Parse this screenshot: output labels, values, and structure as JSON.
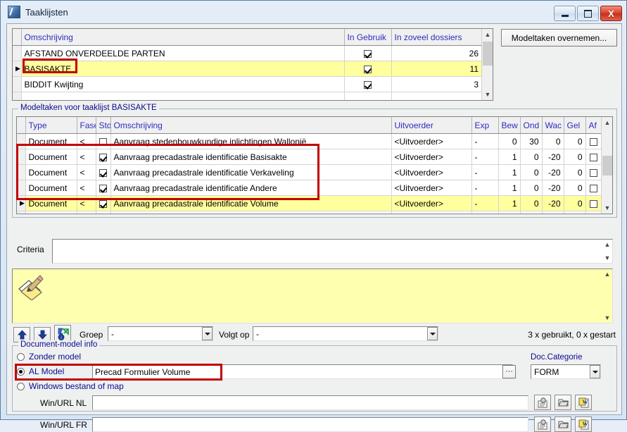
{
  "window": {
    "title": "Taaklijsten",
    "icon": "quill-document-icon",
    "buttons": {
      "minimize": "minimize-icon",
      "maximize": "maximize-icon",
      "close": "X"
    }
  },
  "tasklist_grid": {
    "columns": [
      "Omschrijving",
      "In Gebruik",
      "In zoveel dossiers"
    ],
    "rows": [
      {
        "marker": "",
        "omschrijving": "AFSTAND ONVERDEELDE PARTEN",
        "in_gebruik": true,
        "dossiers": "26",
        "selected": false
      },
      {
        "marker": "▶",
        "omschrijving": "BASISAKTE",
        "in_gebruik": true,
        "dossiers": "11",
        "selected": true
      },
      {
        "marker": "",
        "omschrijving": "BIDDIT Kwijting",
        "in_gebruik": true,
        "dossiers": "3",
        "selected": false
      }
    ]
  },
  "import_button": {
    "label": "Modeltaken overnemen..."
  },
  "modeltaken": {
    "group_label": "Modeltaken voor taaklijst BASISAKTE",
    "columns": [
      "Type",
      "Fase",
      "Std",
      "Omschrijving",
      "Uitvoerder",
      "Exp",
      "Bew",
      "Ond",
      "Wac",
      "Gel",
      "Af"
    ],
    "rows": [
      {
        "marker": "",
        "type": "Document",
        "fase": "<",
        "std": false,
        "omschrijving": "Aanvraag stedenbouwkundige inlichtingen Wallonië",
        "uitvoerder": "<Uitvoerder>",
        "exp": "-",
        "bew": "0",
        "ond": "30",
        "wac": "0",
        "gel": "0",
        "af": false,
        "selected": false
      },
      {
        "marker": "",
        "type": "Document",
        "fase": "<",
        "std": true,
        "omschrijving": "Aanvraag precadastrale identificatie Basisakte",
        "uitvoerder": "<Uitvoerder>",
        "exp": "-",
        "bew": "1",
        "ond": "0",
        "wac": "-20",
        "gel": "0",
        "af": false,
        "selected": false
      },
      {
        "marker": "",
        "type": "Document",
        "fase": "<",
        "std": true,
        "omschrijving": "Aanvraag precadastrale identificatie Verkaveling",
        "uitvoerder": "<Uitvoerder>",
        "exp": "-",
        "bew": "1",
        "ond": "0",
        "wac": "-20",
        "gel": "0",
        "af": false,
        "selected": false
      },
      {
        "marker": "",
        "type": "Document",
        "fase": "<",
        "std": true,
        "omschrijving": "Aanvraag precadastrale identificatie Andere",
        "uitvoerder": "<Uitvoerder>",
        "exp": "-",
        "bew": "1",
        "ond": "0",
        "wac": "-20",
        "gel": "0",
        "af": false,
        "selected": false
      },
      {
        "marker": "▶",
        "type": "Document",
        "fase": "<",
        "std": true,
        "omschrijving": "Aanvraag precadastrale identificatie Volume",
        "uitvoerder": "<Uitvoerder>",
        "exp": "-",
        "bew": "1",
        "ond": "0",
        "wac": "-20",
        "gel": "0",
        "af": false,
        "selected": true
      }
    ]
  },
  "criteria": {
    "label": "Criteria",
    "value": ""
  },
  "memo": {
    "icon": "note-pencil-icon",
    "value": ""
  },
  "toolbar": {
    "move_up": "arrow-up-icon",
    "move_down": "arrow-down-icon",
    "info": "task-info-icon",
    "groep_label": "Groep",
    "groep_value": "-",
    "volgt_op_label": "Volgt op",
    "volgt_op_value": "-",
    "usage_status": "3 x gebruikt, 0 x gestart"
  },
  "document_model_info": {
    "group_label": "Document-model info",
    "options": [
      {
        "label": "Zonder model",
        "selected": false
      },
      {
        "label": "AL Model",
        "selected": true
      },
      {
        "label": "Windows bestand of map",
        "selected": false
      }
    ],
    "al_model_value": "Precad Formulier Volume",
    "browse_button": "···",
    "doc_categorie_label": "Doc.Categorie",
    "doc_categorie_value": "FORM",
    "win_url_nl_label": "Win/URL NL",
    "win_url_nl_value": "",
    "win_url_fr_label": "Win/URL FR",
    "win_url_fr_value": "",
    "row_icons": [
      "document-scan-icon",
      "folder-open-icon",
      "word-document-icon"
    ]
  },
  "colors": {
    "selection_yellow": "#ffff9e",
    "memo_yellow": "#ffffb0",
    "annotation_red": "#c00000",
    "header_text_blue": "#2c2cc0",
    "group_label_blue": "#0a0a8c"
  }
}
